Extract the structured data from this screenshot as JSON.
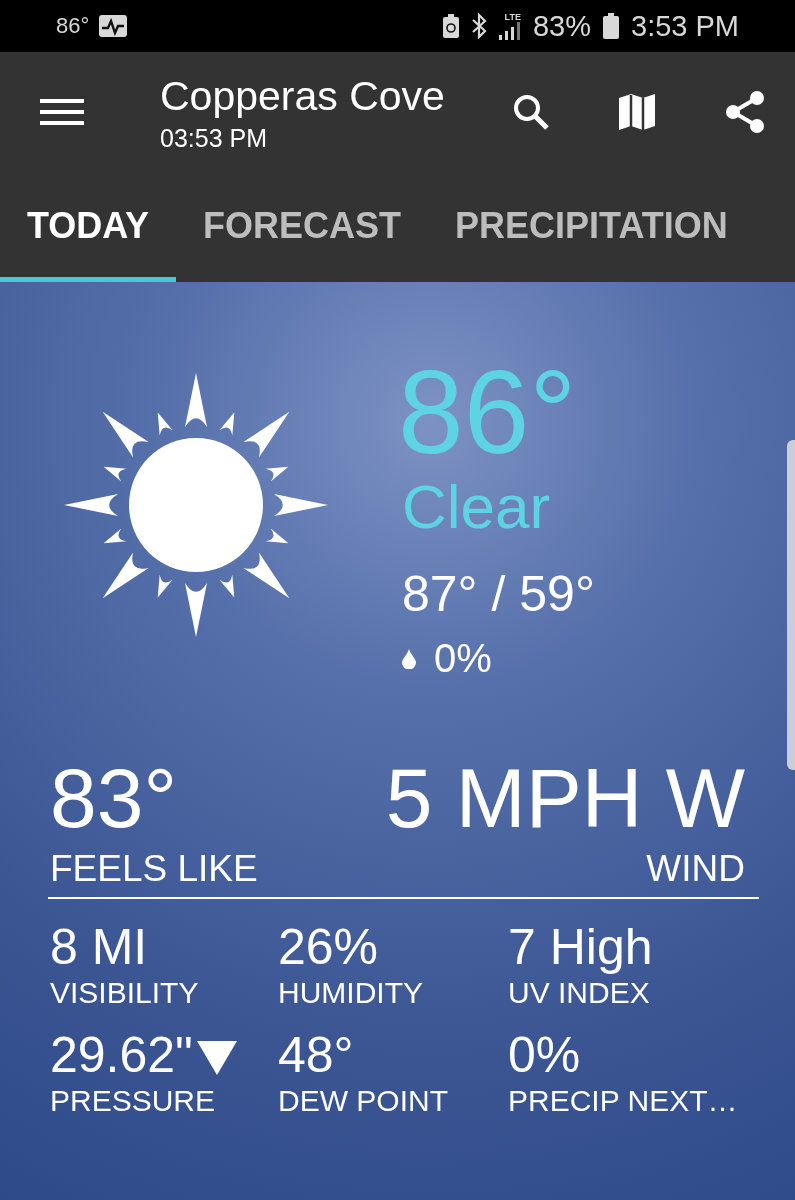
{
  "status_bar": {
    "temperature": "86°",
    "network": "LTE",
    "battery": "83%",
    "time": "3:53 PM"
  },
  "app_bar": {
    "title": "Copperas Cove",
    "subtitle": "03:53 PM"
  },
  "tabs": [
    {
      "label": "TODAY",
      "selected": true
    },
    {
      "label": "FORECAST",
      "selected": false
    },
    {
      "label": "PRECIPITATION",
      "selected": false
    }
  ],
  "current": {
    "temperature": "86°",
    "condition": "Clear",
    "high_low": "87° / 59°",
    "precip_chance": "0%"
  },
  "summary": [
    {
      "value": "83°",
      "label": "FEELS LIKE"
    },
    {
      "value": "5 MPH W",
      "label": "WIND"
    }
  ],
  "details": [
    {
      "value": "8 MI",
      "label": "VISIBILITY"
    },
    {
      "value": "26%",
      "label": "HUMIDITY"
    },
    {
      "value": "7 High",
      "label": "UV INDEX"
    },
    {
      "value": "29.62\"",
      "label": "PRESSURE",
      "falling": true
    },
    {
      "value": "48°",
      "label": "DEW POINT"
    },
    {
      "value": "0%",
      "label": "PRECIP NEXT…"
    }
  ]
}
